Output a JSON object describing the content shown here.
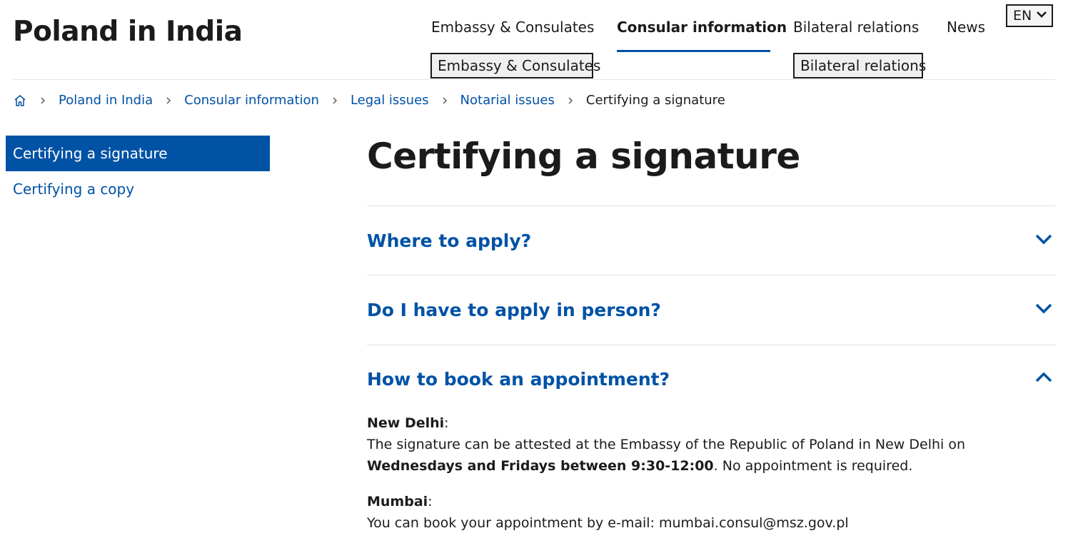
{
  "site": {
    "title": "Poland in India"
  },
  "nav": {
    "items": [
      {
        "label": "Embassy & Consulates"
      },
      {
        "label": "Consular information"
      },
      {
        "label": "Bilateral relations"
      },
      {
        "label": "News"
      }
    ],
    "active_index": 1,
    "submenu_buttons": [
      {
        "label": "Embassy & Consulates"
      },
      {
        "label": "Bilateral relations"
      }
    ],
    "language": "EN"
  },
  "breadcrumb": {
    "items": [
      {
        "label": "Poland in India"
      },
      {
        "label": "Consular information"
      },
      {
        "label": "Legal issues"
      },
      {
        "label": "Notarial issues"
      }
    ],
    "current": "Certifying a signature"
  },
  "sidebar": {
    "items": [
      {
        "label": "Certifying a signature",
        "active": true
      },
      {
        "label": "Certifying a copy",
        "active": false
      }
    ]
  },
  "main": {
    "title": "Certifying a signature",
    "accordion": [
      {
        "question": "Where to apply?",
        "expanded": false
      },
      {
        "question": "Do I have to apply in person?",
        "expanded": false
      },
      {
        "question": "How to book an appointment?",
        "expanded": true
      }
    ],
    "appointment": {
      "new_delhi": {
        "city": "New Delhi",
        "colon": ":",
        "text_before": "The signature can be attested at the Embassy of the Republic of Poland in New Delhi on ",
        "text_bold": "Wednesdays and Fridays between 9:30-12:00",
        "text_after": ". No appointment is required."
      },
      "mumbai": {
        "city": "Mumbai",
        "colon": ":",
        "text": "You can book your appointment by e-mail: mumbai.consul@msz.gov.pl"
      }
    }
  },
  "colors": {
    "accent": "#0052a5",
    "text": "#1b1b1b",
    "divider": "#e0e0e0"
  }
}
